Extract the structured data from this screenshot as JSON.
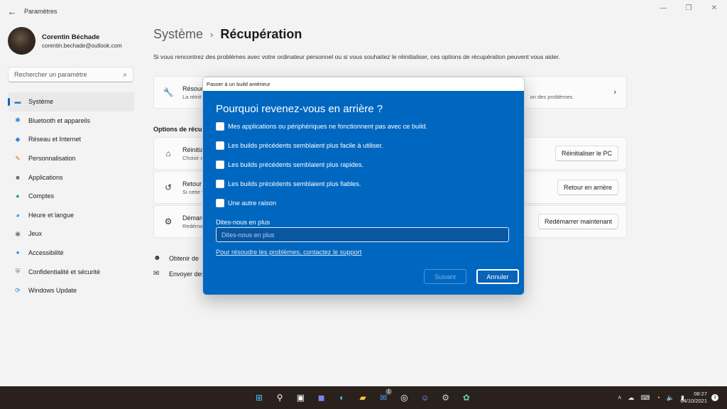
{
  "window": {
    "app_title": "Paramètres",
    "back_icon": "←",
    "minimize": "—",
    "maximize": "❐",
    "close": "✕"
  },
  "profile": {
    "name": "Corentin Béchade",
    "email": "corentin.bechade@outlook.com"
  },
  "search": {
    "placeholder": "Rechercher un paramètre",
    "icon": "⌕"
  },
  "nav": {
    "items": [
      {
        "label": "Système",
        "icon": "▬",
        "color": "#2a86d6"
      },
      {
        "label": "Bluetooth et appareils",
        "icon": "✱",
        "color": "#2a86d6"
      },
      {
        "label": "Réseau et Internet",
        "icon": "◆",
        "color": "#2a86d6"
      },
      {
        "label": "Personnalisation",
        "icon": "✎",
        "color": "#c27b2a"
      },
      {
        "label": "Applications",
        "icon": "■",
        "color": "#5f6f86"
      },
      {
        "label": "Comptes",
        "icon": "●",
        "color": "#22a374"
      },
      {
        "label": "Heure et langue",
        "icon": "◕",
        "color": "#2a86d6"
      },
      {
        "label": "Jeux",
        "icon": "◉",
        "color": "#6b7280"
      },
      {
        "label": "Accessibilité",
        "icon": "✦",
        "color": "#2a86d6"
      },
      {
        "label": "Confidentialité et sécurité",
        "icon": "⛨",
        "color": "#6b7280"
      },
      {
        "label": "Windows Update",
        "icon": "⟳",
        "color": "#2a86d6"
      }
    ]
  },
  "main": {
    "breadcrumb_parent": "Système",
    "breadcrumb_sep": "›",
    "breadcrumb_current": "Récupération",
    "intro": "Si vous rencontrez des problèmes avec votre ordinateur personnel ou si vous souhaitez le réinitialiser, ces options de récupération peuvent vous aider.",
    "troubleshoot": {
      "title": "Résoud",
      "desc_left": "La réinit",
      "desc_right": "on des problèmes.",
      "icon": "🔧",
      "chevron": "›"
    },
    "section_title": "Options de récup",
    "reset": {
      "title": "Réinitia",
      "desc": "Choisir d",
      "button": "Réinitialiser le PC",
      "icon": "⌂"
    },
    "goback": {
      "title": "Retour",
      "desc": "Si cette v",
      "button": "Retour en arrière",
      "icon": "↺"
    },
    "restart": {
      "title": "Démarr",
      "desc": "Redémar",
      "button": "Redémarrer maintenant",
      "icon": "⚙"
    },
    "help_link": {
      "label": "Obtenir de",
      "icon": "☻"
    },
    "feedback_link": {
      "label": "Envoyer des",
      "icon": "✉"
    }
  },
  "dialog": {
    "window_title": "Passer à un build antérieur",
    "heading": "Pourquoi revenez-vous en arrière ?",
    "options": [
      "Mes applications ou périphériques ne fonctionnent pas avec ce build.",
      "Les builds précédents semblaient plus facile à utiliser.",
      "Les builds précédents semblaient plus rapides.",
      "Les builds précédents semblaient plus fiables.",
      "Une autre raison"
    ],
    "tell_label": "Dites-nous en plus",
    "tell_placeholder": "Dites-nous en plus",
    "support_link": "Pour résoudre les problèmes, contactez le support",
    "next_button": "Suivant",
    "cancel_button": "Annuler",
    "accent": "#0067c0"
  },
  "taskbar": {
    "apps": [
      {
        "name": "start",
        "glyph": "⊞",
        "color": "#4cc2ff"
      },
      {
        "name": "search",
        "glyph": "⚲",
        "color": "#ffffff"
      },
      {
        "name": "task-view",
        "glyph": "▣",
        "color": "#ffffff"
      },
      {
        "name": "teams",
        "glyph": "◼",
        "color": "#7b83eb"
      },
      {
        "name": "edge",
        "glyph": "◐",
        "color": "#35c1f1"
      },
      {
        "name": "explorer",
        "glyph": "▰",
        "color": "#f5c342"
      },
      {
        "name": "mail",
        "glyph": "✉",
        "color": "#4aa3ff",
        "badge": "1"
      },
      {
        "name": "dell",
        "glyph": "◎",
        "color": "#ffffff"
      },
      {
        "name": "discord",
        "glyph": "☺",
        "color": "#8c9eff"
      },
      {
        "name": "settings",
        "glyph": "⚙",
        "color": "#cfcfcf"
      },
      {
        "name": "photos",
        "glyph": "✿",
        "color": "#65d1a8"
      }
    ],
    "tray": [
      "˄",
      "☁",
      "⌨",
      "◔",
      "🔈",
      "▮"
    ],
    "time": "08:27",
    "date": "04/10/2021",
    "notif": "1"
  }
}
